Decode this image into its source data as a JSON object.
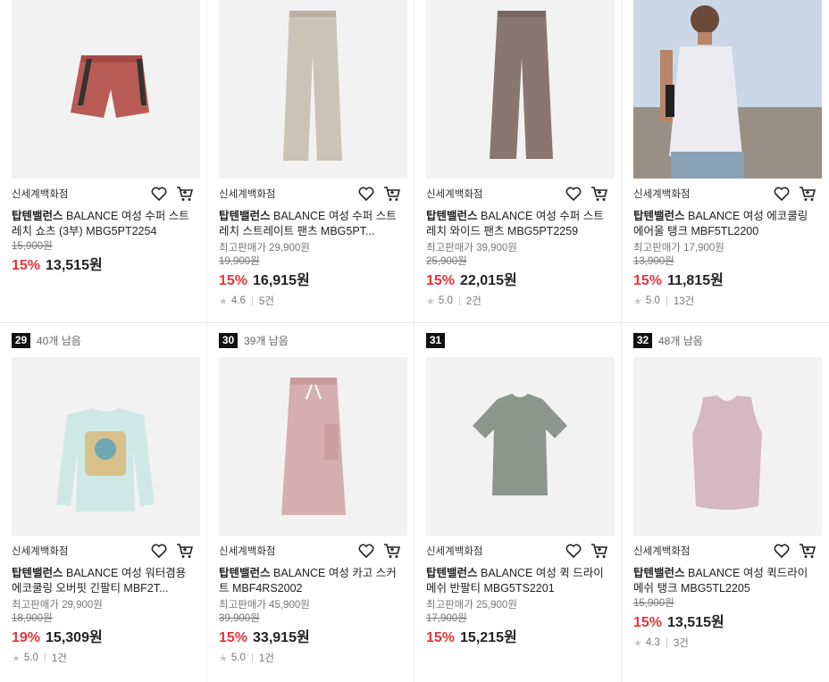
{
  "products": [
    {
      "seller": "신세계백화점",
      "brand": "탑텐밸런스",
      "name": " BALANCE 여성 수퍼 스트레치 쇼츠 (3부) MBG5PT2254",
      "best_price": "",
      "original_price": "15,900원",
      "discount": "15%",
      "price": "13,515원",
      "rating": "",
      "reviews": "",
      "image": "shorts-coral"
    },
    {
      "seller": "신세계백화점",
      "brand": "탑텐밸런스",
      "name": " BALANCE 여성 수퍼 스트레치 스트레이트 팬츠 MBG5PT...",
      "best_price": "최고판매가 29,900원",
      "original_price": "19,900원",
      "discount": "15%",
      "price": "16,915원",
      "rating": "4.6",
      "reviews": "5건",
      "image": "pants-beige"
    },
    {
      "seller": "신세계백화점",
      "brand": "탑텐밸런스",
      "name": " BALANCE 여성 수퍼 스트레치 와이드 팬츠 MBG5PT2259",
      "best_price": "최고판매가 39,900원",
      "original_price": "25,900원",
      "discount": "15%",
      "price": "22,015원",
      "rating": "5.0",
      "reviews": "2건",
      "image": "pants-brown"
    },
    {
      "seller": "신세계백화점",
      "brand": "탑텐밸런스",
      "name": " BALANCE 여성 에코쿨링 에어울 탱크 MBF5TL2200",
      "best_price": "최고판매가 17,900원",
      "original_price": "13,900원",
      "discount": "15%",
      "price": "11,815원",
      "rating": "5.0",
      "reviews": "13건",
      "image": "tank-model"
    },
    {
      "rank": "29",
      "remaining": "40개 남음",
      "seller": "신세계백화점",
      "brand": "탑텐밸런스",
      "name": " BALANCE 여성 워터겸용 에코쿨링 오버핏 긴팔티 MBF2T...",
      "best_price": "최고판매가 29,900원",
      "original_price": "18,900원",
      "discount": "19%",
      "price": "15,309원",
      "rating": "5.0",
      "reviews": "1건",
      "image": "longsleeve-mint"
    },
    {
      "rank": "30",
      "remaining": "39개 남음",
      "seller": "신세계백화점",
      "brand": "탑텐밸런스",
      "name": " BALANCE 여성 카고 스커트 MBF4RS2002",
      "best_price": "최고판매가 45,900원",
      "original_price": "39,900원",
      "discount": "15%",
      "price": "33,915원",
      "rating": "5.0",
      "reviews": "1건",
      "image": "skirt-pink"
    },
    {
      "rank": "31",
      "remaining": "",
      "seller": "신세계백화점",
      "brand": "탑텐밸런스",
      "name": " BALANCE 여성 퀵 드라이 메쉬 반팔티 MBG5TS2201",
      "best_price": "최고판매가 25,900원",
      "original_price": "17,900원",
      "discount": "15%",
      "price": "15,215원",
      "rating": "",
      "reviews": "",
      "image": "tee-green"
    },
    {
      "rank": "32",
      "remaining": "48개 남음",
      "seller": "신세계백화점",
      "brand": "탑텐밸런스",
      "name": " BALANCE 여성 퀵드라이 메쉬 탱크 MBG5TL2205",
      "best_price": "",
      "original_price": "15,900원",
      "discount": "15%",
      "price": "13,515원",
      "rating": "4.3",
      "reviews": "3건",
      "image": "tank-pink"
    }
  ],
  "colors": {
    "discount": "#e8323c",
    "rank_bg": "#111111",
    "thumb_bg": "#f2f2f2"
  },
  "icons": {
    "wishlist": "heart-icon",
    "cart": "cart-icon",
    "rating": "star-icon"
  }
}
